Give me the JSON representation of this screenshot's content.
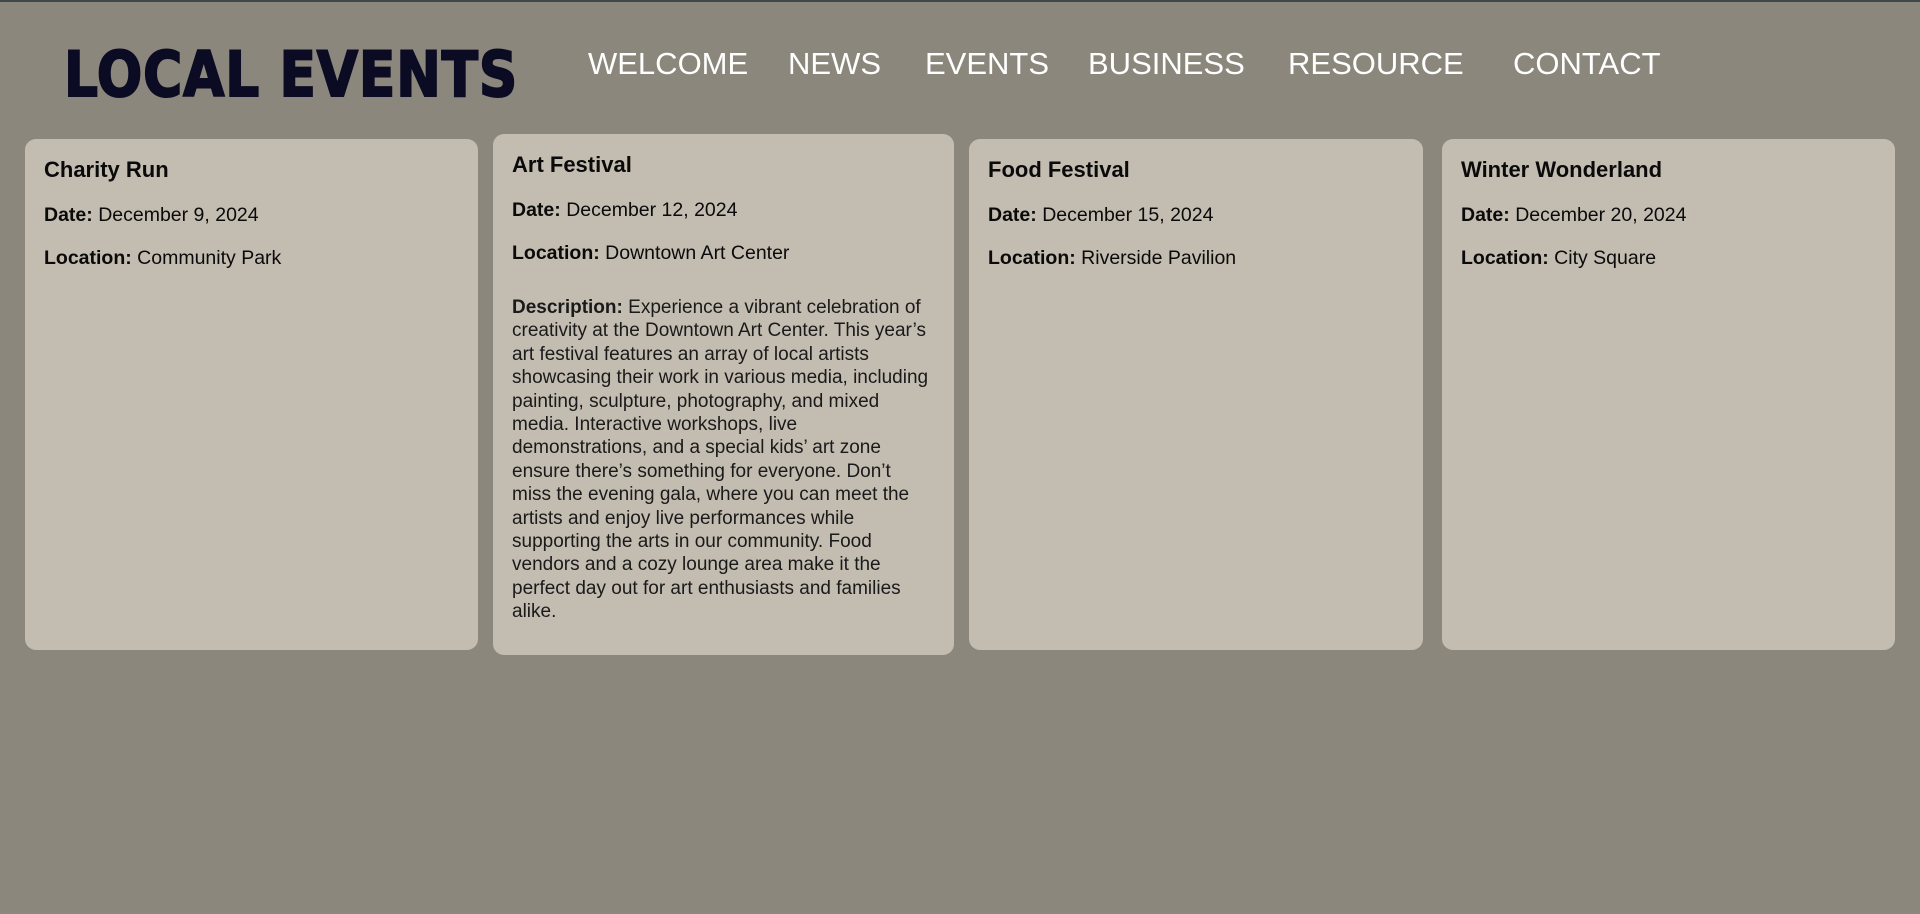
{
  "header": {
    "logo_text": "LOCAL EVENTS",
    "nav": [
      "WELCOME",
      "NEWS",
      "EVENTS",
      "BUSINESS",
      "RESOURCE",
      "CONTACT"
    ]
  },
  "labels": {
    "date": "Date:",
    "location": "Location:",
    "description": "Description:"
  },
  "events": [
    {
      "title": "Charity Run",
      "date": "December 9, 2024",
      "location": "Community Park"
    },
    {
      "title": "Art Festival",
      "date": "December 12, 2024",
      "location": "Downtown Art Center",
      "description": "Experience a vibrant celebration of creativity at the Downtown Art Center. This year’s art festival features an array of local artists showcasing their work in various media, including painting, sculpture, photography, and mixed media. Interactive workshops, live demonstrations, and a special kids’ art zone ensure there’s something for everyone. Don’t miss the evening gala, where you can meet the artists and enjoy live performances while supporting the arts in our community. Food vendors and a cozy lounge area make it the perfect day out for art enthusiasts and families alike."
    },
    {
      "title": "Food Festival",
      "date": "December 15, 2024",
      "location": "Riverside Pavilion"
    },
    {
      "title": "Winter Wonderland",
      "date": "December 20, 2024",
      "location": "City Square"
    }
  ],
  "colors": {
    "page_background": "#8c877c",
    "card_background": "#c3bcb1",
    "logo": "#0b0b23",
    "nav_text": "#ffffff"
  }
}
